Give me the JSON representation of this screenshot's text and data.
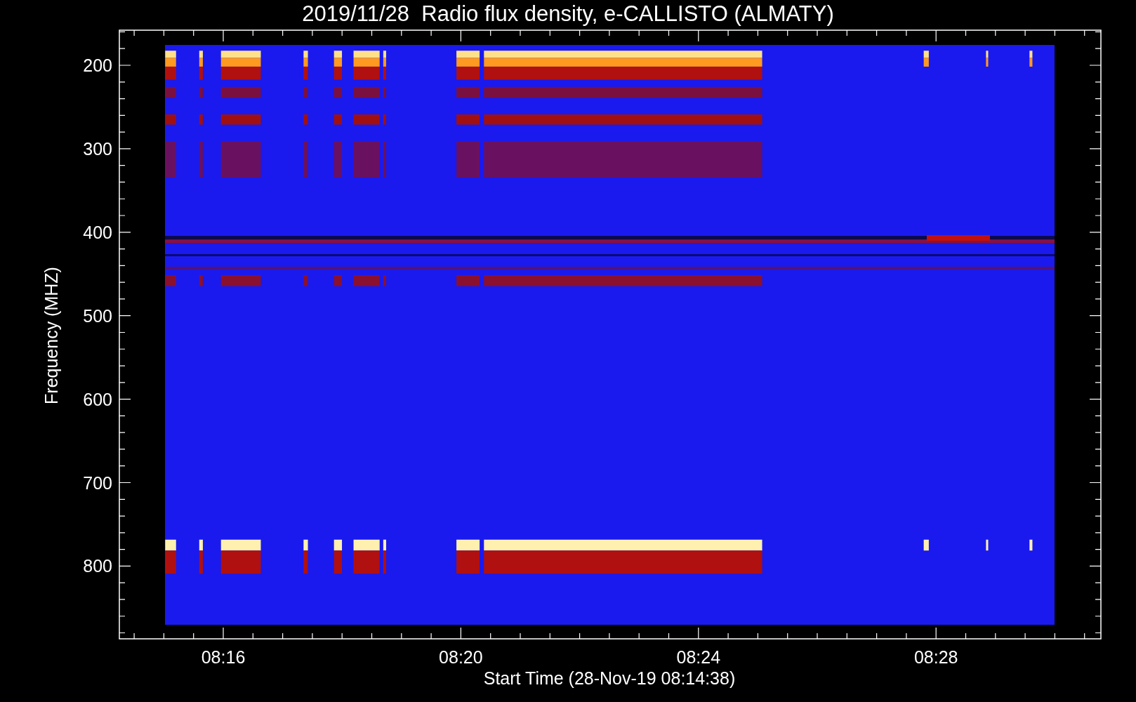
{
  "title": "2019/11/28  Radio flux density, e-CALLISTO (ALMATY)",
  "y_axis": {
    "label": "Frequency (MHZ)",
    "ticks": [
      "200",
      "300",
      "400",
      "500",
      "600",
      "700",
      "800"
    ]
  },
  "x_axis": {
    "label": "Start Time (28-Nov-19 08:14:38)",
    "ticks": [
      "08:16",
      "08:20",
      "08:24",
      "08:28"
    ]
  }
}
